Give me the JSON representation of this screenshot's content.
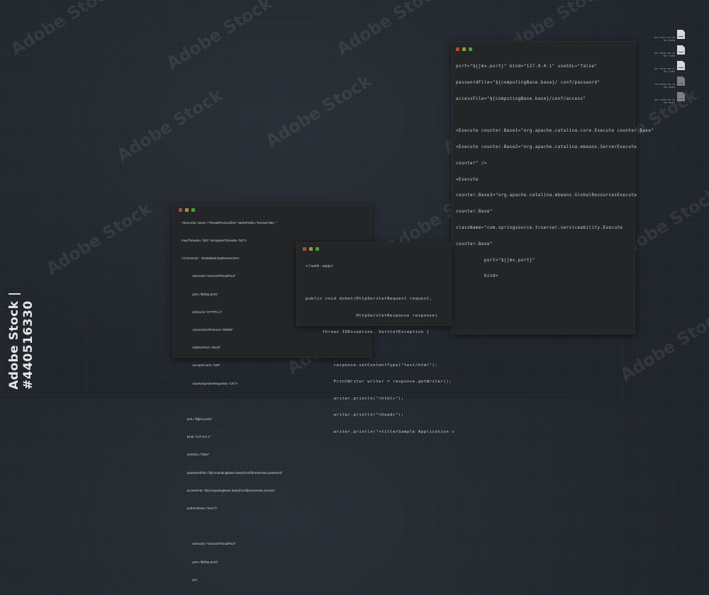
{
  "watermark": "Adobe Stock",
  "stock_id": "Adobe Stock | #440516330",
  "window_controls": {
    "close_color": "#b04a36",
    "minimize_color": "#a39233",
    "maximize_color": "#4e9a3a"
  },
  "window_xml": {
    "lines": [
      "<Executor name=\"ThreadPoolconfine\" namePrefix=\"tomcat-http--\"",
      "maxThreads=\"300\" minSpareThreads=\"50\"/>",
      "<Connector : GlobalNamingResources>",
      "            executor=\"tomcatThreadPool\"",
      "            port=\"${http.port}\"",
      "            protocol=\"HTTP/1.1\"",
      "            connectionTimeout=\"20000\"",
      "            redirectPort=\"8443\"",
      "            acceptCount=\"100\"",
      "            maxKeepAliveRequests=\"15\"/>",
      "",
      "      port=\"${jmx.port}\"",
      "      bind=\"127.0.0.1\"",
      "      useSSL=\"false\"",
      "      passwordFile=\"${computingBase.base}/conf/jmxremote.password\"",
      "      accessFile=\"${computingBase.base}/conf/jmxremote.access\"",
      "      authenticate=\"true\"/>",
      "",
      "            executor=\"tomcatThreadPool\"",
      "            port=\"${http.port}\"",
      "            pro"
    ]
  },
  "window_java": {
    "lines": [
      "</web-app>",
      "",
      "public void doGet(HttpServletRequest request,",
      "                  HttpServletResponse response)",
      "      throws IOException, ServletException {",
      "",
      "          response.setContentType(\"text/html\");",
      "          PrintWriter writer = response.getWriter();",
      "          writer.println(\"<html>\");",
      "          writer.println(\"<head>\");",
      "          writer.println(\"<title>Sample Application c"
    ]
  },
  "window_config": {
    "lines": [
      "port=\"${jmx.port}\" bind=\"127.0.0.1\" useSSL=\"false\"",
      "passwordFile=\"${computingBase.base}/ conf/password\"",
      "accessFile=\"${computingBase.base}/conf/access\"",
      "",
      "<Execute counter.Base1=\"org.apache.catalina.core.Execute counter.Base\"",
      "<Execute counter.Base2=\"org.apache.catalina.mbeans.ServerExecute",
      "counter\" />",
      "<Execute",
      "counter.Base3=\"org.apache.catalina.mbeans.GlobalResourcesExecute",
      "counter.Base\"",
      "className=\"com.springsource.tcserver.serviceability.Execute",
      "counter.Base\"",
      "          port=\"${jmx.port}\"",
      "          bind="
    ]
  },
  "file_list": [
    {
      "line1": "001 07077 010 00",
      "line2": "001 00700",
      "icon": "file-icon"
    },
    {
      "line1": "001 00000 001 01",
      "line2": "003 71000",
      "icon": "file-icon"
    },
    {
      "line1": "001 70700 000 77",
      "line2": "003 71000",
      "icon": "file-icon"
    },
    {
      "line1": "700 00000 001 70",
      "line2": "700 00000",
      "icon": "file-icon"
    },
    {
      "line1": "001 71000 007 00",
      "line2": "700 00700",
      "icon": "file-icon"
    }
  ]
}
